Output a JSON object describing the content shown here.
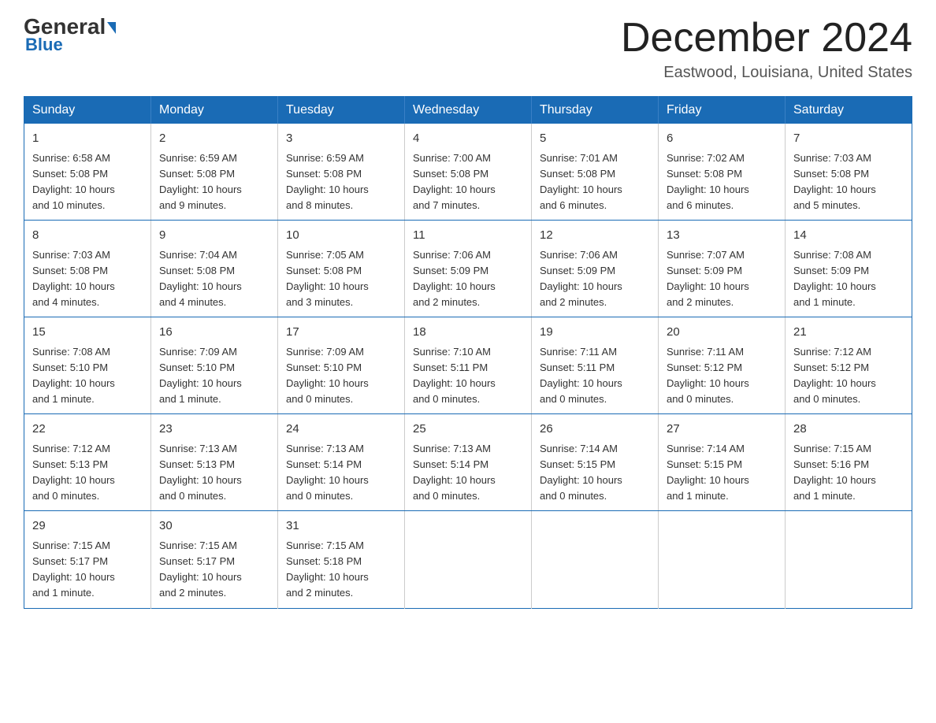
{
  "header": {
    "logo_general": "General",
    "logo_blue": "Blue",
    "month_year": "December 2024",
    "location": "Eastwood, Louisiana, United States"
  },
  "days_of_week": [
    "Sunday",
    "Monday",
    "Tuesday",
    "Wednesday",
    "Thursday",
    "Friday",
    "Saturday"
  ],
  "weeks": [
    [
      {
        "day": "1",
        "info": "Sunrise: 6:58 AM\nSunset: 5:08 PM\nDaylight: 10 hours\nand 10 minutes."
      },
      {
        "day": "2",
        "info": "Sunrise: 6:59 AM\nSunset: 5:08 PM\nDaylight: 10 hours\nand 9 minutes."
      },
      {
        "day": "3",
        "info": "Sunrise: 6:59 AM\nSunset: 5:08 PM\nDaylight: 10 hours\nand 8 minutes."
      },
      {
        "day": "4",
        "info": "Sunrise: 7:00 AM\nSunset: 5:08 PM\nDaylight: 10 hours\nand 7 minutes."
      },
      {
        "day": "5",
        "info": "Sunrise: 7:01 AM\nSunset: 5:08 PM\nDaylight: 10 hours\nand 6 minutes."
      },
      {
        "day": "6",
        "info": "Sunrise: 7:02 AM\nSunset: 5:08 PM\nDaylight: 10 hours\nand 6 minutes."
      },
      {
        "day": "7",
        "info": "Sunrise: 7:03 AM\nSunset: 5:08 PM\nDaylight: 10 hours\nand 5 minutes."
      }
    ],
    [
      {
        "day": "8",
        "info": "Sunrise: 7:03 AM\nSunset: 5:08 PM\nDaylight: 10 hours\nand 4 minutes."
      },
      {
        "day": "9",
        "info": "Sunrise: 7:04 AM\nSunset: 5:08 PM\nDaylight: 10 hours\nand 4 minutes."
      },
      {
        "day": "10",
        "info": "Sunrise: 7:05 AM\nSunset: 5:08 PM\nDaylight: 10 hours\nand 3 minutes."
      },
      {
        "day": "11",
        "info": "Sunrise: 7:06 AM\nSunset: 5:09 PM\nDaylight: 10 hours\nand 2 minutes."
      },
      {
        "day": "12",
        "info": "Sunrise: 7:06 AM\nSunset: 5:09 PM\nDaylight: 10 hours\nand 2 minutes."
      },
      {
        "day": "13",
        "info": "Sunrise: 7:07 AM\nSunset: 5:09 PM\nDaylight: 10 hours\nand 2 minutes."
      },
      {
        "day": "14",
        "info": "Sunrise: 7:08 AM\nSunset: 5:09 PM\nDaylight: 10 hours\nand 1 minute."
      }
    ],
    [
      {
        "day": "15",
        "info": "Sunrise: 7:08 AM\nSunset: 5:10 PM\nDaylight: 10 hours\nand 1 minute."
      },
      {
        "day": "16",
        "info": "Sunrise: 7:09 AM\nSunset: 5:10 PM\nDaylight: 10 hours\nand 1 minute."
      },
      {
        "day": "17",
        "info": "Sunrise: 7:09 AM\nSunset: 5:10 PM\nDaylight: 10 hours\nand 0 minutes."
      },
      {
        "day": "18",
        "info": "Sunrise: 7:10 AM\nSunset: 5:11 PM\nDaylight: 10 hours\nand 0 minutes."
      },
      {
        "day": "19",
        "info": "Sunrise: 7:11 AM\nSunset: 5:11 PM\nDaylight: 10 hours\nand 0 minutes."
      },
      {
        "day": "20",
        "info": "Sunrise: 7:11 AM\nSunset: 5:12 PM\nDaylight: 10 hours\nand 0 minutes."
      },
      {
        "day": "21",
        "info": "Sunrise: 7:12 AM\nSunset: 5:12 PM\nDaylight: 10 hours\nand 0 minutes."
      }
    ],
    [
      {
        "day": "22",
        "info": "Sunrise: 7:12 AM\nSunset: 5:13 PM\nDaylight: 10 hours\nand 0 minutes."
      },
      {
        "day": "23",
        "info": "Sunrise: 7:13 AM\nSunset: 5:13 PM\nDaylight: 10 hours\nand 0 minutes."
      },
      {
        "day": "24",
        "info": "Sunrise: 7:13 AM\nSunset: 5:14 PM\nDaylight: 10 hours\nand 0 minutes."
      },
      {
        "day": "25",
        "info": "Sunrise: 7:13 AM\nSunset: 5:14 PM\nDaylight: 10 hours\nand 0 minutes."
      },
      {
        "day": "26",
        "info": "Sunrise: 7:14 AM\nSunset: 5:15 PM\nDaylight: 10 hours\nand 0 minutes."
      },
      {
        "day": "27",
        "info": "Sunrise: 7:14 AM\nSunset: 5:15 PM\nDaylight: 10 hours\nand 1 minute."
      },
      {
        "day": "28",
        "info": "Sunrise: 7:15 AM\nSunset: 5:16 PM\nDaylight: 10 hours\nand 1 minute."
      }
    ],
    [
      {
        "day": "29",
        "info": "Sunrise: 7:15 AM\nSunset: 5:17 PM\nDaylight: 10 hours\nand 1 minute."
      },
      {
        "day": "30",
        "info": "Sunrise: 7:15 AM\nSunset: 5:17 PM\nDaylight: 10 hours\nand 2 minutes."
      },
      {
        "day": "31",
        "info": "Sunrise: 7:15 AM\nSunset: 5:18 PM\nDaylight: 10 hours\nand 2 minutes."
      },
      {
        "day": "",
        "info": ""
      },
      {
        "day": "",
        "info": ""
      },
      {
        "day": "",
        "info": ""
      },
      {
        "day": "",
        "info": ""
      }
    ]
  ]
}
